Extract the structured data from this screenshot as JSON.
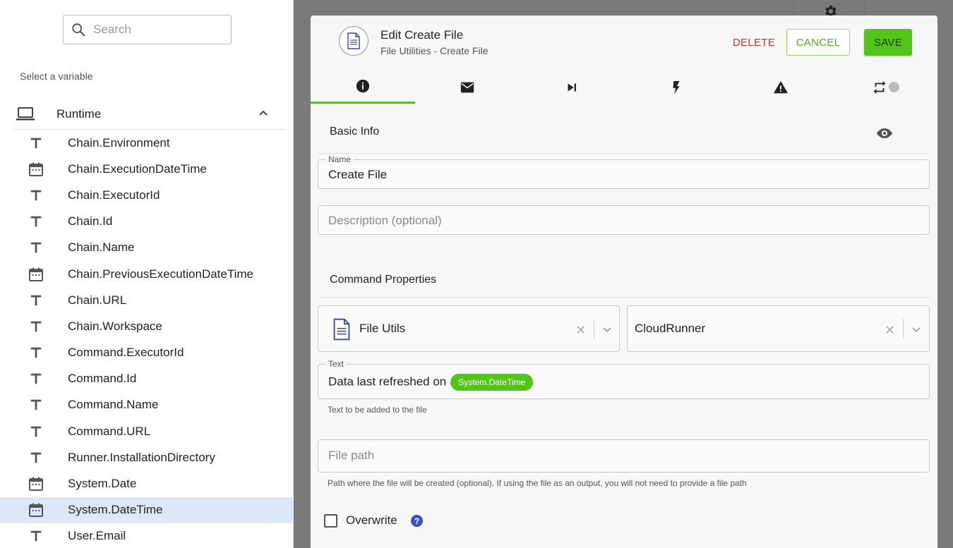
{
  "picker": {
    "search_placeholder": "Search",
    "select_label": "Select a variable",
    "group": {
      "label": "Runtime",
      "icon": "laptop-icon",
      "expanded": true
    },
    "variables": [
      {
        "name": "Chain.Environment",
        "type": "text",
        "selected": false
      },
      {
        "name": "Chain.ExecutionDateTime",
        "type": "date",
        "selected": false
      },
      {
        "name": "Chain.ExecutorId",
        "type": "text",
        "selected": false
      },
      {
        "name": "Chain.Id",
        "type": "text",
        "selected": false
      },
      {
        "name": "Chain.Name",
        "type": "text",
        "selected": false
      },
      {
        "name": "Chain.PreviousExecutionDateTime",
        "type": "date",
        "selected": false
      },
      {
        "name": "Chain.URL",
        "type": "text",
        "selected": false
      },
      {
        "name": "Chain.Workspace",
        "type": "text",
        "selected": false
      },
      {
        "name": "Command.ExecutorId",
        "type": "text",
        "selected": false
      },
      {
        "name": "Command.Id",
        "type": "text",
        "selected": false
      },
      {
        "name": "Command.Name",
        "type": "text",
        "selected": false
      },
      {
        "name": "Command.URL",
        "type": "text",
        "selected": false
      },
      {
        "name": "Runner.InstallationDirectory",
        "type": "text",
        "selected": false
      },
      {
        "name": "System.Date",
        "type": "date",
        "selected": false
      },
      {
        "name": "System.DateTime",
        "type": "date",
        "selected": true
      },
      {
        "name": "User.Email",
        "type": "text",
        "selected": false
      }
    ]
  },
  "modal": {
    "title": "Edit Create File",
    "subtitle": "File Utilities - Create File",
    "delete_label": "DELETE",
    "cancel_label": "CANCEL",
    "save_label": "SAVE",
    "tabs": [
      {
        "icon": "info-icon",
        "active": true
      },
      {
        "icon": "mail-icon",
        "active": false
      },
      {
        "icon": "skip-next-icon",
        "active": false
      },
      {
        "icon": "lightning-icon",
        "active": false
      },
      {
        "icon": "warning-icon",
        "active": false
      },
      {
        "icon": "repeat-toggle-icon",
        "active": false
      }
    ],
    "basic_info_title": "Basic Info",
    "name_label": "Name",
    "name_value": "Create File",
    "description_placeholder": "Description (optional)",
    "command_properties_title": "Command Properties",
    "command_select": "File Utils",
    "runner_select": "CloudRunner",
    "text_label": "Text",
    "text_value": "Data last refreshed on",
    "text_chip": "System.DateTime",
    "text_helper": "Text to be added to the file",
    "file_path_placeholder": "File path",
    "file_path_helper": "Path where the file will be created (optional). If using the file as an output, you will not need to provide a file path",
    "overwrite_label": "Overwrite",
    "overwrite_checked": false,
    "help_glyph": "?"
  },
  "colors": {
    "accent_green": "#52c41a",
    "delete_red": "#d32f2f",
    "selected_row": "#dce8f7",
    "help_blue": "#3f51b5"
  }
}
